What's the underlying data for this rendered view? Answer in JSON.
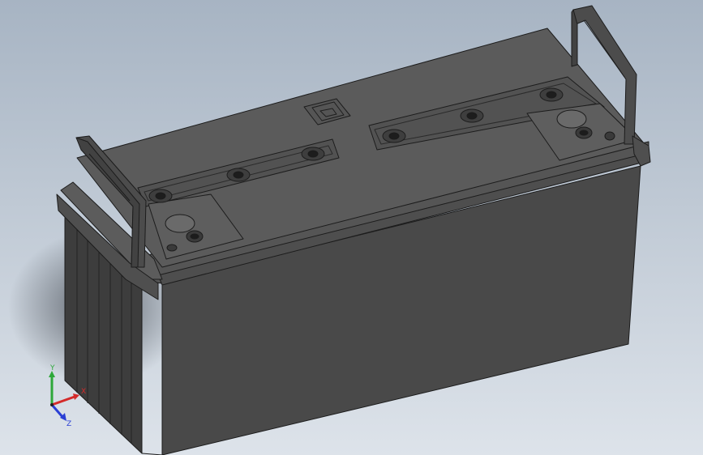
{
  "viewport": {
    "background_top": "#a7b4c3",
    "background_bottom": "#dde3ea"
  },
  "model": {
    "body_color": "#4a4a4a",
    "edge_color": "#1c1c1c",
    "top_color": "#5a5a5a"
  },
  "triad": {
    "x_label": "X",
    "y_label": "Y",
    "z_label": "Z",
    "x_color": "#d42a2a",
    "y_color": "#2ea83a",
    "z_color": "#2a3fd4"
  }
}
